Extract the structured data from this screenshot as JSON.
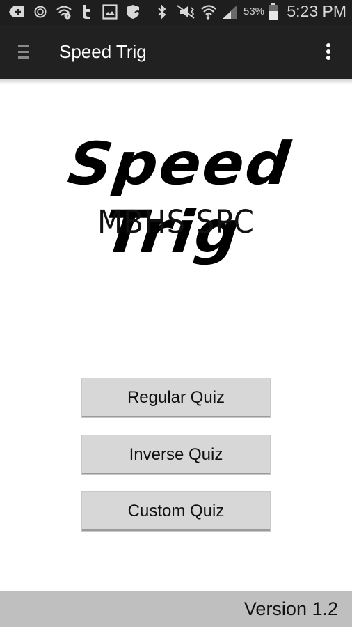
{
  "status_bar": {
    "left_icons": [
      "add-notification-icon",
      "circle-notification-icon",
      "wifi-question-icon",
      "tumblr-icon",
      "gallery-icon",
      "shield-sync-icon"
    ],
    "right_icons": [
      "bluetooth-icon",
      "vibrate-mute-icon",
      "wifi-icon",
      "signal-icon",
      "battery-icon"
    ],
    "battery_percent": "53%",
    "time": "5:23 PM"
  },
  "app_bar": {
    "title": "Speed Trig",
    "menu_icon": "hamburger-icon",
    "overflow_icon": "more-vert-icon"
  },
  "logo": {
    "title": "Speed Trig",
    "subtitle": "MBHS SPC"
  },
  "buttons": [
    {
      "label": "Regular Quiz"
    },
    {
      "label": "Inverse Quiz"
    },
    {
      "label": "Custom Quiz"
    }
  ],
  "footer": {
    "version": "Version 1.2"
  }
}
